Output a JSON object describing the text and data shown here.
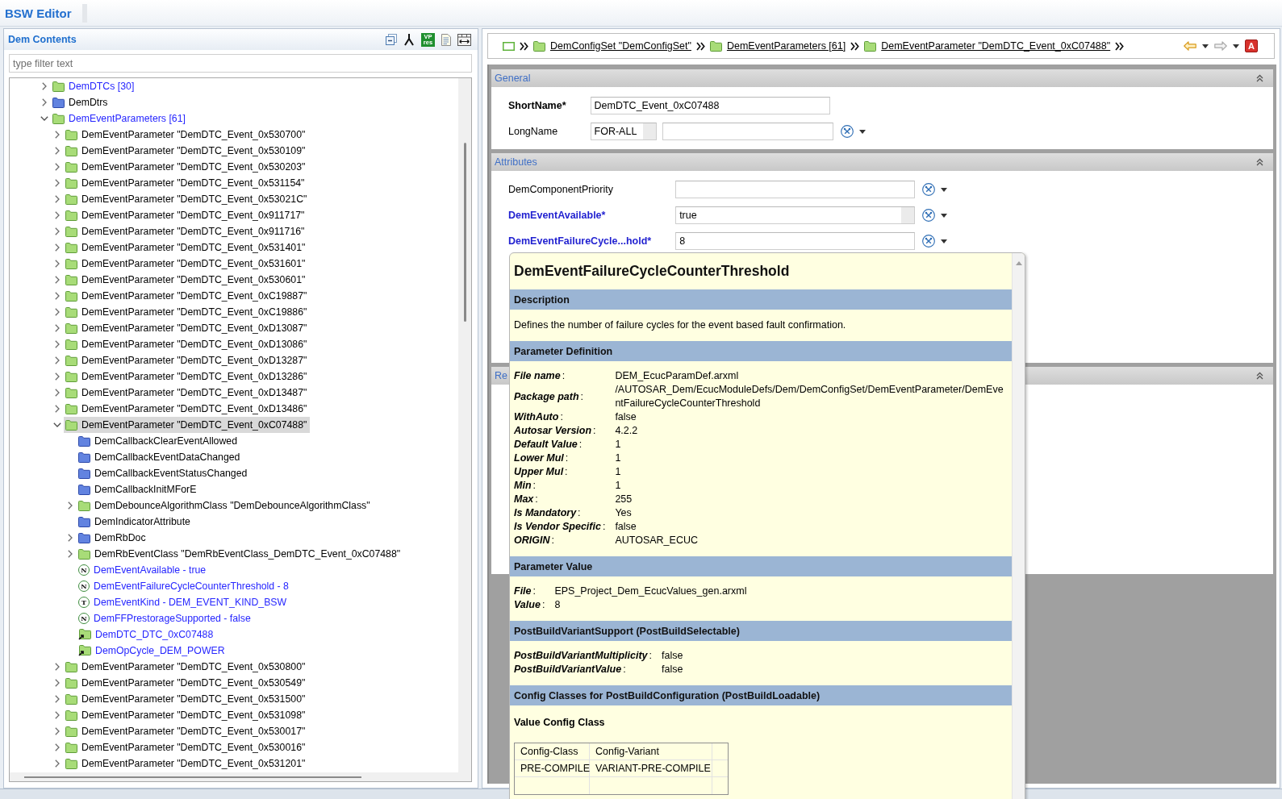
{
  "title_bar": {
    "title": "BSW Editor"
  },
  "contents_panel": {
    "title": "Dem Contents",
    "toolbar_tile": "VP res",
    "filter": {
      "placeholder": "type filter text"
    },
    "tree": {
      "items": [
        {
          "label": "DemDTCs [30]",
          "kind": "container",
          "color": "#2626ff",
          "expanded": false,
          "selected": false
        },
        {
          "label": "DemDtrs",
          "kind": "group",
          "color": "#000000",
          "expanded": false,
          "selected": false
        },
        {
          "label": "DemEventParameters [61]",
          "kind": "container",
          "color": "#2626ff",
          "expanded": true,
          "selected": false,
          "children": [
            {
              "label": "DemEventParameter \"DemDTC_Event_0x530700\"",
              "kind": "container",
              "color": "#000000",
              "expanded": false,
              "selected": false
            },
            {
              "label": "DemEventParameter \"DemDTC_Event_0x530109\"",
              "kind": "container",
              "color": "#000000",
              "expanded": false,
              "selected": false
            },
            {
              "label": "DemEventParameter \"DemDTC_Event_0x530203\"",
              "kind": "container",
              "color": "#000000",
              "expanded": false,
              "selected": false
            },
            {
              "label": "DemEventParameter \"DemDTC_Event_0x531154\"",
              "kind": "container",
              "color": "#000000",
              "expanded": false,
              "selected": false
            },
            {
              "label": "DemEventParameter \"DemDTC_Event_0x53021C\"",
              "kind": "container",
              "color": "#000000",
              "expanded": false,
              "selected": false
            },
            {
              "label": "DemEventParameter \"DemDTC_Event_0x911717\"",
              "kind": "container",
              "color": "#000000",
              "expanded": false,
              "selected": false
            },
            {
              "label": "DemEventParameter \"DemDTC_Event_0x911716\"",
              "kind": "container",
              "color": "#000000",
              "expanded": false,
              "selected": false
            },
            {
              "label": "DemEventParameter \"DemDTC_Event_0x531401\"",
              "kind": "container",
              "color": "#000000",
              "expanded": false,
              "selected": false
            },
            {
              "label": "DemEventParameter \"DemDTC_Event_0x531601\"",
              "kind": "container",
              "color": "#000000",
              "expanded": false,
              "selected": false
            },
            {
              "label": "DemEventParameter \"DemDTC_Event_0x530601\"",
              "kind": "container",
              "color": "#000000",
              "expanded": false,
              "selected": false
            },
            {
              "label": "DemEventParameter \"DemDTC_Event_0xC19887\"",
              "kind": "container",
              "color": "#000000",
              "expanded": false,
              "selected": false
            },
            {
              "label": "DemEventParameter \"DemDTC_Event_0xC19886\"",
              "kind": "container",
              "color": "#000000",
              "expanded": false,
              "selected": false
            },
            {
              "label": "DemEventParameter \"DemDTC_Event_0xD13087\"",
              "kind": "container",
              "color": "#000000",
              "expanded": false,
              "selected": false
            },
            {
              "label": "DemEventParameter \"DemDTC_Event_0xD13086\"",
              "kind": "container",
              "color": "#000000",
              "expanded": false,
              "selected": false
            },
            {
              "label": "DemEventParameter \"DemDTC_Event_0xD13287\"",
              "kind": "container",
              "color": "#000000",
              "expanded": false,
              "selected": false
            },
            {
              "label": "DemEventParameter \"DemDTC_Event_0xD13286\"",
              "kind": "container",
              "color": "#000000",
              "expanded": false,
              "selected": false
            },
            {
              "label": "DemEventParameter \"DemDTC_Event_0xD13487\"",
              "kind": "container",
              "color": "#000000",
              "expanded": false,
              "selected": false
            },
            {
              "label": "DemEventParameter \"DemDTC_Event_0xD13486\"",
              "kind": "container",
              "color": "#000000",
              "expanded": false,
              "selected": false
            },
            {
              "label": "DemEventParameter \"DemDTC_Event_0xC07488\"",
              "kind": "container",
              "color": "#000000",
              "expanded": true,
              "selected": true,
              "children": [
                {
                  "label": "DemCallbackClearEventAllowed",
                  "kind": "group",
                  "color": "#000000",
                  "selected": false
                },
                {
                  "label": "DemCallbackEventDataChanged",
                  "kind": "group",
                  "color": "#000000",
                  "selected": false
                },
                {
                  "label": "DemCallbackEventStatusChanged",
                  "kind": "group",
                  "color": "#000000",
                  "selected": false
                },
                {
                  "label": "DemCallbackInitMForE",
                  "kind": "group",
                  "color": "#000000",
                  "selected": false
                },
                {
                  "label": "DemDebounceAlgorithmClass \"DemDebounceAlgorithmClass\"",
                  "kind": "container",
                  "color": "#000000",
                  "expanded": false,
                  "selected": false
                },
                {
                  "label": "DemIndicatorAttribute",
                  "kind": "group",
                  "color": "#000000",
                  "selected": false
                },
                {
                  "label": "DemRbDoc",
                  "kind": "group",
                  "color": "#000000",
                  "expanded": false,
                  "selected": false
                },
                {
                  "label": "DemRbEventClass \"DemRbEventClass_DemDTC_Event_0xC07488\"",
                  "kind": "container",
                  "color": "#000000",
                  "expanded": false,
                  "selected": false
                },
                {
                  "label": "DemEventAvailable - true",
                  "kind": "value",
                  "badge": "N",
                  "color": "#2626ff",
                  "selected": false
                },
                {
                  "label": "DemEventFailureCycleCounterThreshold - 8",
                  "kind": "value",
                  "badge": "N",
                  "color": "#2626ff",
                  "selected": false
                },
                {
                  "label": "DemEventKind - DEM_EVENT_KIND_BSW",
                  "kind": "value",
                  "badge": "T",
                  "color": "#2626ff",
                  "selected": false
                },
                {
                  "label": "DemFFPrestorageSupported - false",
                  "kind": "value",
                  "badge": "N",
                  "color": "#2626ff",
                  "selected": false
                },
                {
                  "label": "DemDTC_DTC_0xC07488",
                  "kind": "reference",
                  "color": "#2626ff",
                  "selected": false
                },
                {
                  "label": "DemOpCycle_DEM_POWER",
                  "kind": "reference",
                  "color": "#2626ff",
                  "selected": false
                }
              ]
            },
            {
              "label": "DemEventParameter \"DemDTC_Event_0x530800\"",
              "kind": "container",
              "color": "#000000",
              "expanded": false,
              "selected": false
            },
            {
              "label": "DemEventParameter \"DemDTC_Event_0x530549\"",
              "kind": "container",
              "color": "#000000",
              "expanded": false,
              "selected": false
            },
            {
              "label": "DemEventParameter \"DemDTC_Event_0x531500\"",
              "kind": "container",
              "color": "#000000",
              "expanded": false,
              "selected": false
            },
            {
              "label": "DemEventParameter \"DemDTC_Event_0x531098\"",
              "kind": "container",
              "color": "#000000",
              "expanded": false,
              "selected": false
            },
            {
              "label": "DemEventParameter \"DemDTC_Event_0x530017\"",
              "kind": "container",
              "color": "#000000",
              "expanded": false,
              "selected": false
            },
            {
              "label": "DemEventParameter \"DemDTC_Event_0x530016\"",
              "kind": "container",
              "color": "#000000",
              "expanded": false,
              "selected": false
            },
            {
              "label": "DemEventParameter \"DemDTC_Event_0x531201\"",
              "kind": "container",
              "color": "#000000",
              "expanded": false,
              "selected": false
            }
          ]
        }
      ]
    }
  },
  "editor": {
    "breadcrumb": {
      "crumbs": [
        "DemConfigSet \"DemConfigSet\"",
        "DemEventParameters [61]",
        "DemEventParameter \"DemDTC_Event_0xC07488\""
      ],
      "back": {
        "disabled": false
      },
      "forward": {
        "disabled": true
      },
      "action": "A"
    },
    "sections": [
      {
        "title": "General",
        "fields": [
          {
            "label": "ShortName*",
            "bold": true,
            "color": "#000000",
            "kind": "text",
            "value": "DemDTC_Event_0xC07488",
            "tools": false
          },
          {
            "label": "LongName",
            "bold": false,
            "color": "#000000",
            "kind": "language",
            "language": "FOR-ALL",
            "tools": true
          }
        ]
      },
      {
        "title": "Attributes",
        "fields": [
          {
            "label": "DemComponentPriority",
            "bold": false,
            "color": "#000000",
            "kind": "text",
            "tools": true
          },
          {
            "label": "DemEventAvailable*",
            "bold": true,
            "color": "#1f1fd0",
            "kind": "combo",
            "value": "true",
            "tools": true
          },
          {
            "label": "DemEventFailureCycle...hold*",
            "bold": true,
            "color": "#1f1fd0",
            "kind": "text",
            "value": "8",
            "tools": true
          }
        ]
      },
      {
        "title": "Re"
      }
    ]
  },
  "tooltip": {
    "title": "DemEventFailureCycleCounterThreshold",
    "sections": [
      {
        "heading": "Description",
        "kind": "text",
        "text": "Defines the number of failure cycles for the event based fault confirmation."
      },
      {
        "heading": "Parameter Definition",
        "kind": "properties",
        "rows": [
          {
            "label": "**File name**:",
            "value": "DEM_EcucParamDef.arxml"
          },
          {
            "label": "**Package path**:",
            "value": "/AUTOSAR_Dem/EcucModuleDefs/Dem/DemConfigSet/DemEventParameter/DemEventFailureCycleCounterThreshold"
          },
          {
            "label": "**WithAuto**:",
            "value": "false"
          },
          {
            "label": "**Autosar Version**:",
            "value": "4.2.2"
          },
          {
            "label": "**Default Value**:",
            "value": "1"
          },
          {
            "label": "**Lower Mul**:",
            "value": "1"
          },
          {
            "label": "**Upper Mul**:",
            "value": "1"
          },
          {
            "label": "**Min**:",
            "value": "1"
          },
          {
            "label": "**Max**:",
            "value": "255"
          },
          {
            "label": "**Is Mandatory**:",
            "value": "Yes"
          },
          {
            "label": "**Is Vendor Specific**:",
            "value": "false"
          },
          {
            "label": "**ORIGIN**:",
            "value": "AUTOSAR_ECUC"
          }
        ]
      },
      {
        "heading": "Parameter Value",
        "kind": "properties",
        "rows": [
          {
            "label": "**File**:",
            "value": "EPS_Project_Dem_EcucValues_gen.arxml"
          },
          {
            "label": "**Value**:",
            "value": "8"
          }
        ]
      },
      {
        "heading": "PostBuildVariantSupport (PostBuildSelectable)",
        "kind": "properties",
        "rows": [
          {
            "label": "**PostBuildVariantMultiplicity**:",
            "value": "false"
          },
          {
            "label": "**PostBuildVariantValue**:",
            "value": "false"
          }
        ]
      },
      {
        "heading": "Config Classes for PostBuildConfiguration (PostBuildLoadable)",
        "kind": "table",
        "subheading": "Value Config Class",
        "columns": [
          "Config-Class",
          "Config-Variant"
        ],
        "rows": [
          [
            "PRE-COMPILE",
            "VARIANT-PRE-COMPILE"
          ]
        ]
      }
    ]
  }
}
